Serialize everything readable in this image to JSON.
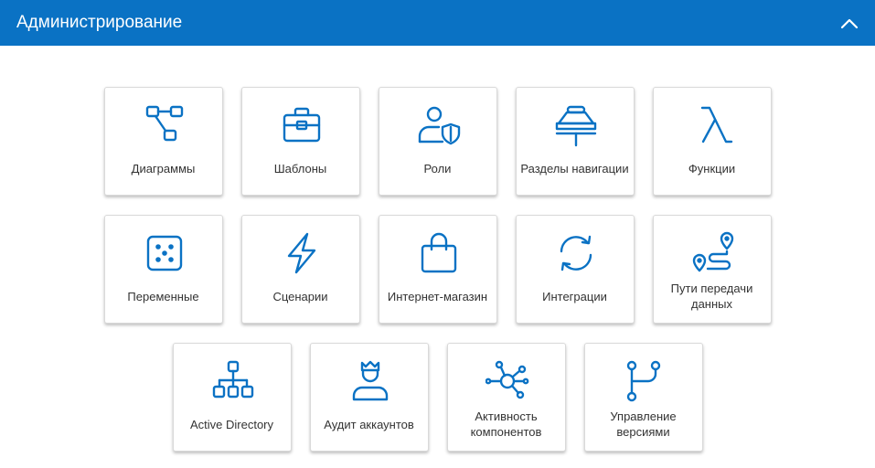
{
  "header": {
    "title": "Администрирование",
    "collapse_icon": "chevron-up-icon"
  },
  "accent": "#0a72c4",
  "tiles": [
    {
      "label": "Диаграммы",
      "icon": "diagram-icon"
    },
    {
      "label": "Шаблоны",
      "icon": "briefcase-icon"
    },
    {
      "label": "Роли",
      "icon": "user-shield-icon"
    },
    {
      "label": "Разделы навигации",
      "icon": "navigation-sections-icon"
    },
    {
      "label": "Функции",
      "icon": "lambda-icon"
    },
    {
      "label": "Переменные",
      "icon": "dice-icon"
    },
    {
      "label": "Сценарии",
      "icon": "lightning-icon"
    },
    {
      "label": "Интернет-магазин",
      "icon": "shopping-bag-icon"
    },
    {
      "label": "Интеграции",
      "icon": "sync-icon"
    },
    {
      "label": "Пути передачи данных",
      "icon": "route-icon"
    },
    {
      "label": "Active Directory",
      "icon": "hierarchy-icon"
    },
    {
      "label": "Аудит аккаунтов",
      "icon": "user-crown-icon"
    },
    {
      "label": "Активность компонентов",
      "icon": "network-nodes-icon"
    },
    {
      "label": "Управление версиями",
      "icon": "git-branch-icon"
    }
  ]
}
